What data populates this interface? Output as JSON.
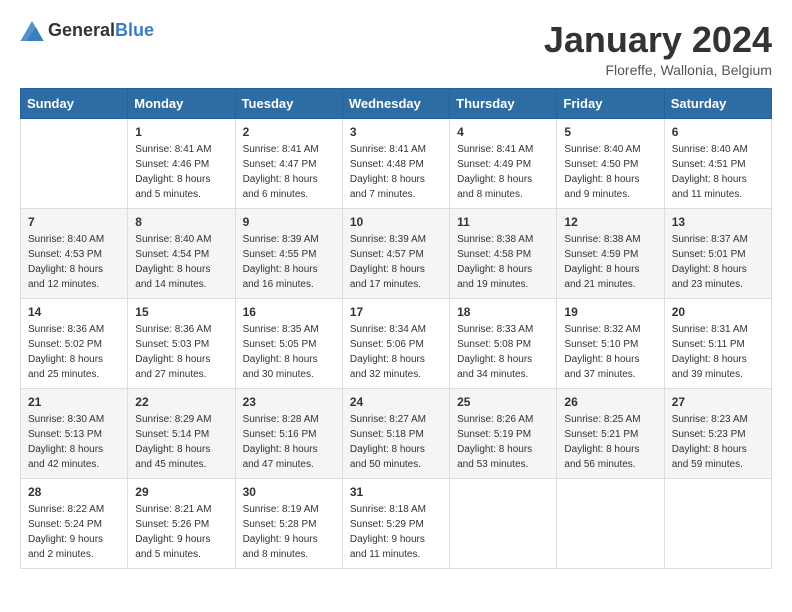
{
  "header": {
    "logo_general": "General",
    "logo_blue": "Blue",
    "month_year": "January 2024",
    "location": "Floreffe, Wallonia, Belgium"
  },
  "weekdays": [
    "Sunday",
    "Monday",
    "Tuesday",
    "Wednesday",
    "Thursday",
    "Friday",
    "Saturday"
  ],
  "weeks": [
    [
      {
        "day": "",
        "info": ""
      },
      {
        "day": "1",
        "info": "Sunrise: 8:41 AM\nSunset: 4:46 PM\nDaylight: 8 hours\nand 5 minutes."
      },
      {
        "day": "2",
        "info": "Sunrise: 8:41 AM\nSunset: 4:47 PM\nDaylight: 8 hours\nand 6 minutes."
      },
      {
        "day": "3",
        "info": "Sunrise: 8:41 AM\nSunset: 4:48 PM\nDaylight: 8 hours\nand 7 minutes."
      },
      {
        "day": "4",
        "info": "Sunrise: 8:41 AM\nSunset: 4:49 PM\nDaylight: 8 hours\nand 8 minutes."
      },
      {
        "day": "5",
        "info": "Sunrise: 8:40 AM\nSunset: 4:50 PM\nDaylight: 8 hours\nand 9 minutes."
      },
      {
        "day": "6",
        "info": "Sunrise: 8:40 AM\nSunset: 4:51 PM\nDaylight: 8 hours\nand 11 minutes."
      }
    ],
    [
      {
        "day": "7",
        "info": "Sunrise: 8:40 AM\nSunset: 4:53 PM\nDaylight: 8 hours\nand 12 minutes."
      },
      {
        "day": "8",
        "info": "Sunrise: 8:40 AM\nSunset: 4:54 PM\nDaylight: 8 hours\nand 14 minutes."
      },
      {
        "day": "9",
        "info": "Sunrise: 8:39 AM\nSunset: 4:55 PM\nDaylight: 8 hours\nand 16 minutes."
      },
      {
        "day": "10",
        "info": "Sunrise: 8:39 AM\nSunset: 4:57 PM\nDaylight: 8 hours\nand 17 minutes."
      },
      {
        "day": "11",
        "info": "Sunrise: 8:38 AM\nSunset: 4:58 PM\nDaylight: 8 hours\nand 19 minutes."
      },
      {
        "day": "12",
        "info": "Sunrise: 8:38 AM\nSunset: 4:59 PM\nDaylight: 8 hours\nand 21 minutes."
      },
      {
        "day": "13",
        "info": "Sunrise: 8:37 AM\nSunset: 5:01 PM\nDaylight: 8 hours\nand 23 minutes."
      }
    ],
    [
      {
        "day": "14",
        "info": "Sunrise: 8:36 AM\nSunset: 5:02 PM\nDaylight: 8 hours\nand 25 minutes."
      },
      {
        "day": "15",
        "info": "Sunrise: 8:36 AM\nSunset: 5:03 PM\nDaylight: 8 hours\nand 27 minutes."
      },
      {
        "day": "16",
        "info": "Sunrise: 8:35 AM\nSunset: 5:05 PM\nDaylight: 8 hours\nand 30 minutes."
      },
      {
        "day": "17",
        "info": "Sunrise: 8:34 AM\nSunset: 5:06 PM\nDaylight: 8 hours\nand 32 minutes."
      },
      {
        "day": "18",
        "info": "Sunrise: 8:33 AM\nSunset: 5:08 PM\nDaylight: 8 hours\nand 34 minutes."
      },
      {
        "day": "19",
        "info": "Sunrise: 8:32 AM\nSunset: 5:10 PM\nDaylight: 8 hours\nand 37 minutes."
      },
      {
        "day": "20",
        "info": "Sunrise: 8:31 AM\nSunset: 5:11 PM\nDaylight: 8 hours\nand 39 minutes."
      }
    ],
    [
      {
        "day": "21",
        "info": "Sunrise: 8:30 AM\nSunset: 5:13 PM\nDaylight: 8 hours\nand 42 minutes."
      },
      {
        "day": "22",
        "info": "Sunrise: 8:29 AM\nSunset: 5:14 PM\nDaylight: 8 hours\nand 45 minutes."
      },
      {
        "day": "23",
        "info": "Sunrise: 8:28 AM\nSunset: 5:16 PM\nDaylight: 8 hours\nand 47 minutes."
      },
      {
        "day": "24",
        "info": "Sunrise: 8:27 AM\nSunset: 5:18 PM\nDaylight: 8 hours\nand 50 minutes."
      },
      {
        "day": "25",
        "info": "Sunrise: 8:26 AM\nSunset: 5:19 PM\nDaylight: 8 hours\nand 53 minutes."
      },
      {
        "day": "26",
        "info": "Sunrise: 8:25 AM\nSunset: 5:21 PM\nDaylight: 8 hours\nand 56 minutes."
      },
      {
        "day": "27",
        "info": "Sunrise: 8:23 AM\nSunset: 5:23 PM\nDaylight: 8 hours\nand 59 minutes."
      }
    ],
    [
      {
        "day": "28",
        "info": "Sunrise: 8:22 AM\nSunset: 5:24 PM\nDaylight: 9 hours\nand 2 minutes."
      },
      {
        "day": "29",
        "info": "Sunrise: 8:21 AM\nSunset: 5:26 PM\nDaylight: 9 hours\nand 5 minutes."
      },
      {
        "day": "30",
        "info": "Sunrise: 8:19 AM\nSunset: 5:28 PM\nDaylight: 9 hours\nand 8 minutes."
      },
      {
        "day": "31",
        "info": "Sunrise: 8:18 AM\nSunset: 5:29 PM\nDaylight: 9 hours\nand 11 minutes."
      },
      {
        "day": "",
        "info": ""
      },
      {
        "day": "",
        "info": ""
      },
      {
        "day": "",
        "info": ""
      }
    ]
  ]
}
